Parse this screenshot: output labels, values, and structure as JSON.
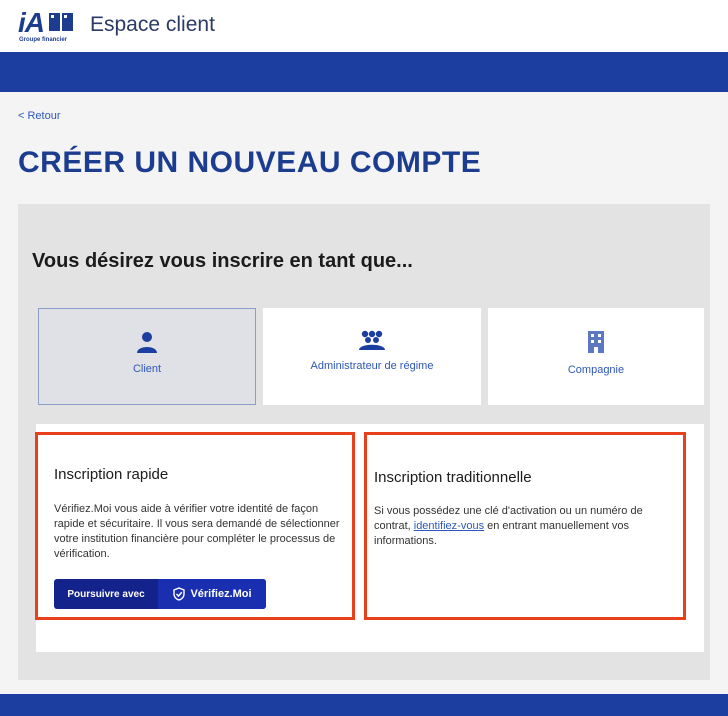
{
  "header": {
    "logo_text": "iA",
    "logo_subtext": "Groupe financier",
    "app_title": "Espace client"
  },
  "nav": {
    "back_label": "< Retour"
  },
  "page": {
    "title": "CRÉER UN NOUVEAU COMPTE",
    "question": "Vous désirez vous inscrire en tant que..."
  },
  "options": [
    {
      "label": "Client",
      "icon": "person-icon",
      "selected": true
    },
    {
      "label": "Administrateur de régime",
      "icon": "group-icon",
      "selected": false
    },
    {
      "label": "Compagnie",
      "icon": "building-icon",
      "selected": false
    }
  ],
  "quick": {
    "title": "Inscription rapide",
    "text": "Vérifiez.Moi vous aide à vérifier votre identité de façon rapide et sécuritaire. Il vous sera demandé de sélectionner votre institution financière pour compléter le processus de vérification.",
    "button_left": "Poursuivre avec",
    "button_right": "Vérifiez.Moi"
  },
  "traditional": {
    "title": "Inscription traditionnelle",
    "text_before": "Si vous possédez une clé d'activation ou un numéro de contrat,",
    "link": "identifiez-vous",
    "text_after": "en entrant manuellement vos informations."
  },
  "colors": {
    "brand_blue": "#1c3ea0",
    "title_blue": "#1c3d8f",
    "link_blue": "#2e57b8",
    "highlight_red": "#e8401c",
    "button_navy": "#14238c"
  }
}
